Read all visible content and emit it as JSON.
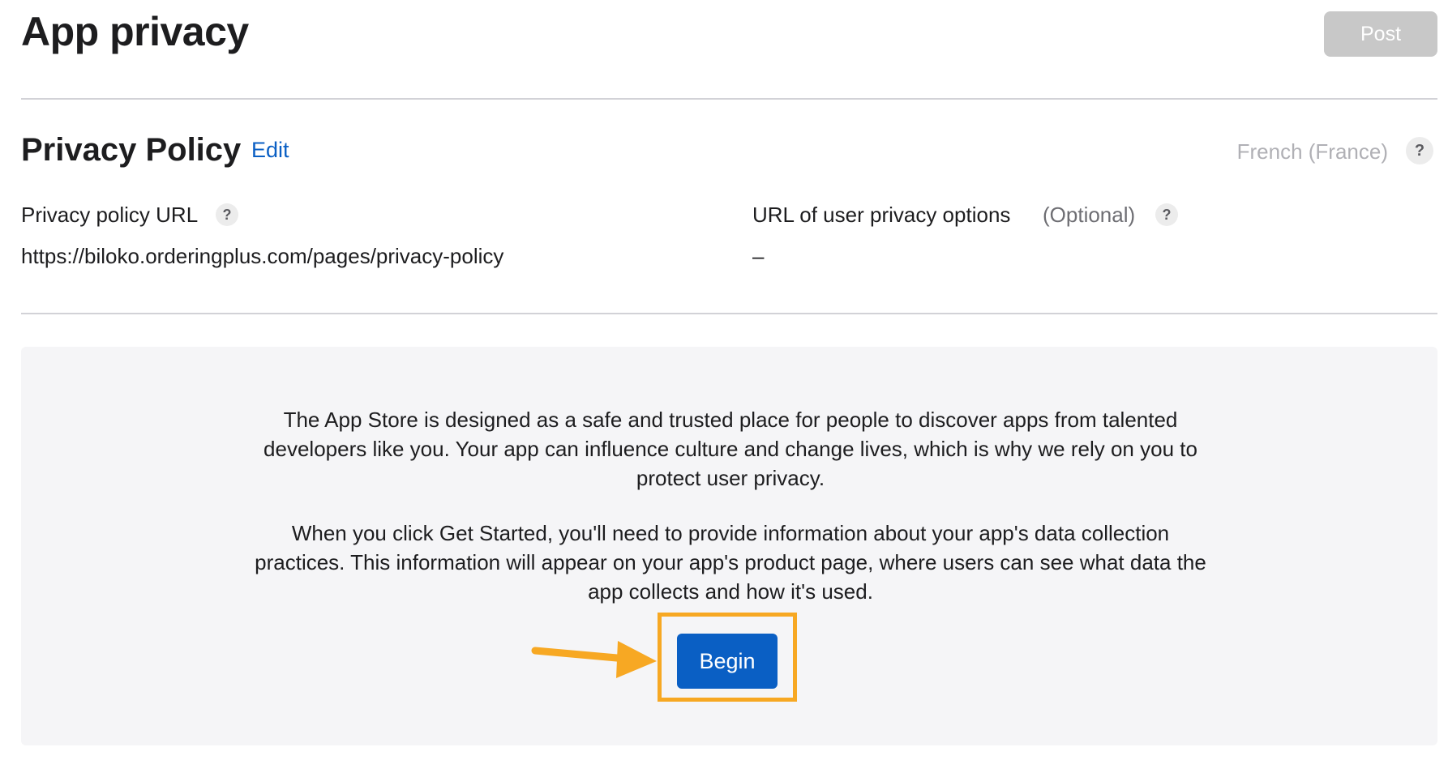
{
  "header": {
    "title": "App privacy",
    "post_label": "Post"
  },
  "privacy_policy": {
    "title": "Privacy Policy",
    "edit_label": "Edit",
    "language": "French (France)",
    "help_symbol": "?",
    "policy_url_label": "Privacy policy URL",
    "policy_url_value": "https://biloko.orderingplus.com/pages/privacy-policy",
    "choices_url_label": "URL of user privacy options",
    "choices_url_optional": "(Optional)",
    "choices_url_value": "–"
  },
  "info_panel": {
    "paragraph_1": "The App Store is designed as a safe and trusted place for people to discover apps from talented developers like you. Your app can influence culture and change lives, which is why we rely on you to protect user privacy.",
    "paragraph_2": "When you click Get Started, you'll need to provide information about your app's data collection practices. This information will appear on your app's product page, where users can see what data the app collects and how it's used.",
    "begin_label": "Begin"
  },
  "colors": {
    "accent_blue": "#0a5fc4",
    "highlight_orange": "#f7a823",
    "disabled_gray": "#c8c8c8",
    "panel_bg": "#f5f5f7"
  },
  "icons": {
    "help": "question-mark-circle-icon",
    "annotation": "arrow-right-icon"
  }
}
